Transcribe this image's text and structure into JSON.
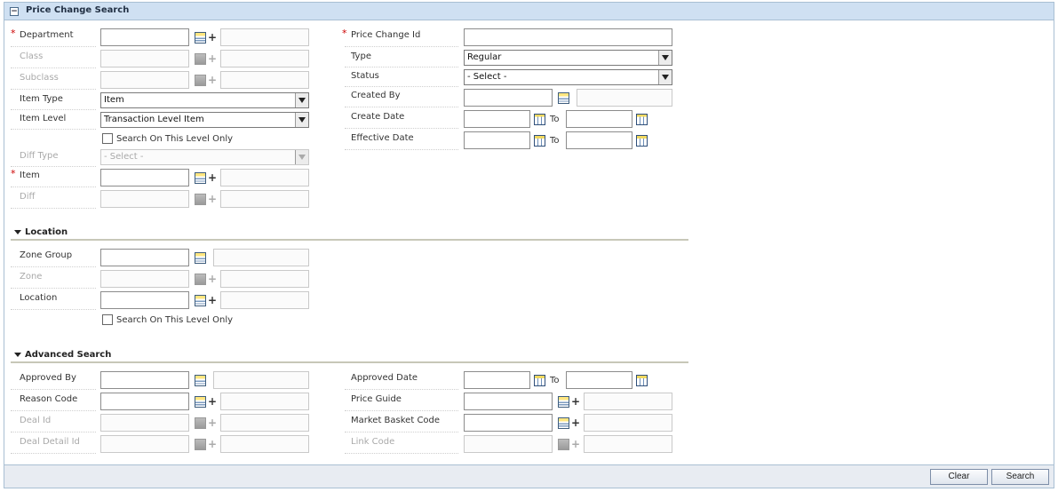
{
  "panel": {
    "title": "Price Change Search"
  },
  "left": {
    "department": {
      "label": "Department",
      "required": "*"
    },
    "class": {
      "label": "Class"
    },
    "subclass": {
      "label": "Subclass"
    },
    "item_type": {
      "label": "Item Type",
      "value": "Item"
    },
    "item_level": {
      "label": "Item Level",
      "value": "Transaction Level Item"
    },
    "search_level_only": {
      "label": "Search On This Level Only",
      "checked": false
    },
    "diff_type": {
      "label": "Diff Type",
      "value": "- Select -"
    },
    "item": {
      "label": "Item",
      "required": "*"
    },
    "diff": {
      "label": "Diff"
    }
  },
  "right": {
    "price_change_id": {
      "label": "Price Change Id",
      "required": "*"
    },
    "type": {
      "label": "Type",
      "value": "Regular"
    },
    "status": {
      "label": "Status",
      "value": "- Select -"
    },
    "created_by": {
      "label": "Created By"
    },
    "create_date": {
      "label": "Create Date",
      "to": "To"
    },
    "effective_date": {
      "label": "Effective Date",
      "to": "To"
    }
  },
  "location": {
    "title": "Location",
    "zone_group": {
      "label": "Zone Group"
    },
    "zone": {
      "label": "Zone"
    },
    "location": {
      "label": "Location"
    },
    "search_level_only": {
      "label": "Search On This Level Only",
      "checked": false
    }
  },
  "advanced": {
    "title": "Advanced Search",
    "approved_by": {
      "label": "Approved By"
    },
    "reason_code": {
      "label": "Reason Code"
    },
    "deal_id": {
      "label": "Deal Id"
    },
    "deal_detail_id": {
      "label": "Deal Detail Id"
    },
    "approved_date": {
      "label": "Approved Date",
      "to": "To"
    },
    "price_guide": {
      "label": "Price Guide"
    },
    "market_basket_code": {
      "label": "Market Basket Code"
    },
    "link_code": {
      "label": "Link Code"
    }
  },
  "footer": {
    "clear_label": "Clear",
    "search_label": "Search"
  },
  "icons": {
    "collapse": "collapse-icon",
    "lov": "list-of-values-icon",
    "calendar": "calendar-icon",
    "expand_section": "triangle-down-icon"
  },
  "colors": {
    "header_bg": "#cfe0f2",
    "required": "#cc0000",
    "border": "#a9bfd3"
  }
}
